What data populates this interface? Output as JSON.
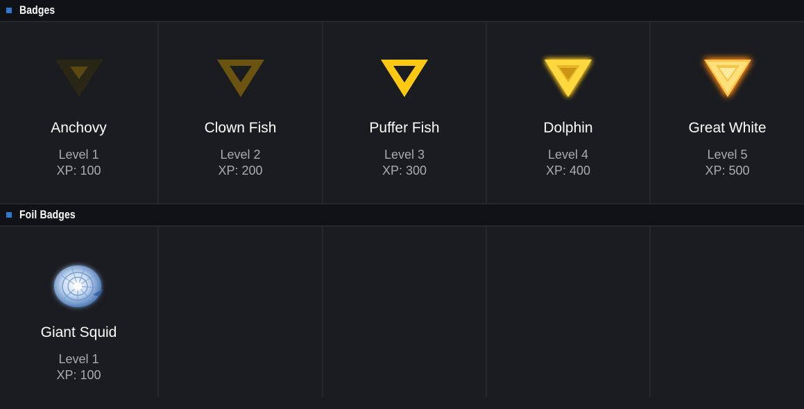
{
  "sections": {
    "badges": {
      "title": "Badges",
      "items": [
        {
          "name": "Anchovy",
          "level": "Level 1",
          "xp": "XP: 100",
          "icon": "triangle-badge-icon"
        },
        {
          "name": "Clown Fish",
          "level": "Level 2",
          "xp": "XP: 200",
          "icon": "triangle-badge-icon"
        },
        {
          "name": "Puffer Fish",
          "level": "Level 3",
          "xp": "XP: 300",
          "icon": "triangle-badge-icon"
        },
        {
          "name": "Dolphin",
          "level": "Level 4",
          "xp": "XP: 400",
          "icon": "glowing-triangle-badge-icon"
        },
        {
          "name": "Great White",
          "level": "Level 5",
          "xp": "XP: 500",
          "icon": "glowing-triangle-badge-icon"
        }
      ]
    },
    "foil": {
      "title": "Foil Badges",
      "items": [
        {
          "name": "Giant Squid",
          "level": "Level 1",
          "xp": "XP: 100",
          "icon": "nautilus-shell-icon"
        }
      ]
    }
  },
  "colors": {
    "background": "#1b1c20",
    "header_background": "#111215",
    "accent_marker": "#2f78d0",
    "badge_gold": "#ffc812"
  }
}
